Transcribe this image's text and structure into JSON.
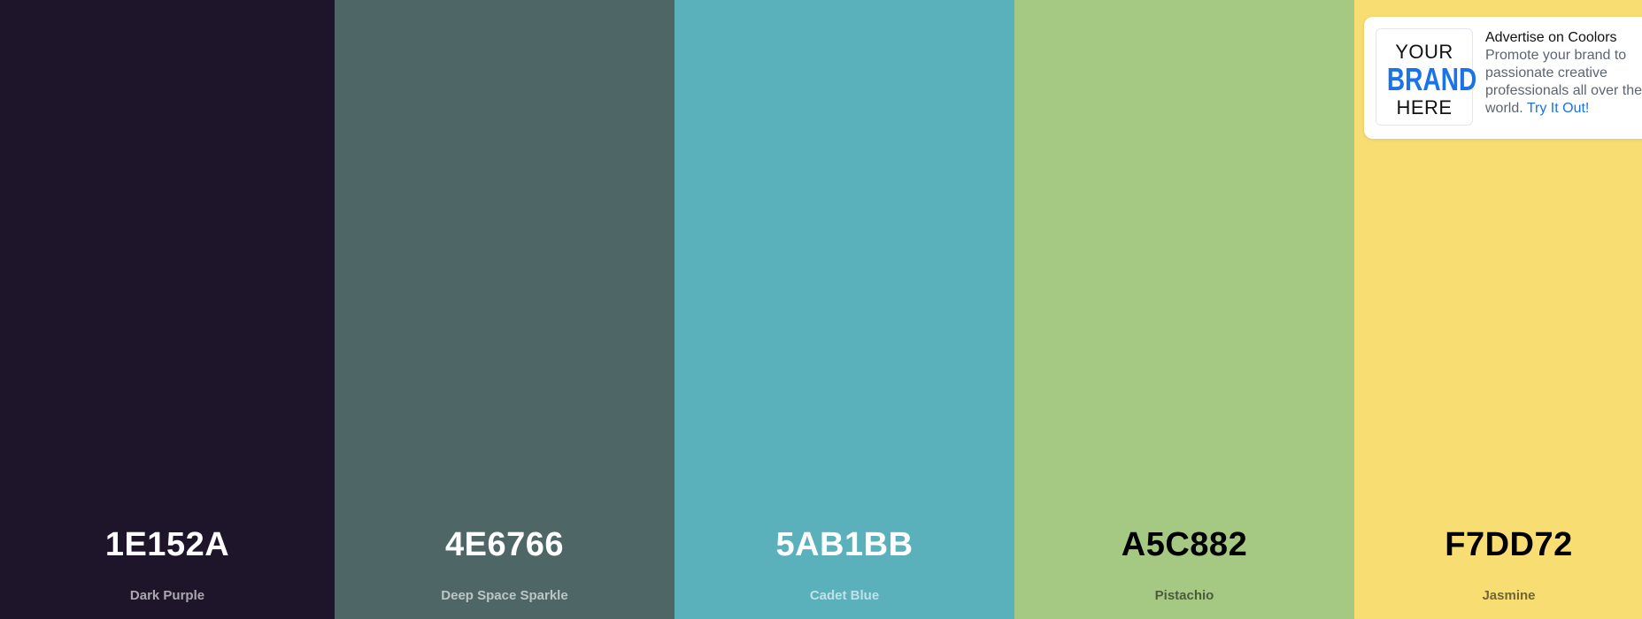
{
  "palette": {
    "colors": [
      {
        "hex": "1E152A",
        "name": "Dark Purple",
        "color": "#1E152A"
      },
      {
        "hex": "4E6766",
        "name": "Deep Space Sparkle",
        "color": "#4E6766"
      },
      {
        "hex": "5AB1BB",
        "name": "Cadet Blue",
        "color": "#5AB1BB"
      },
      {
        "hex": "A5C882",
        "name": "Pistachio",
        "color": "#A5C882"
      },
      {
        "hex": "F7DD72",
        "name": "Jasmine",
        "color": "#F7DD72"
      }
    ]
  },
  "ad": {
    "logo_line1": "YOUR",
    "logo_line2": "BRAND",
    "logo_line3": "HERE",
    "title": "Advertise on Coolors",
    "body": "Promote your brand to passionate creative professionals all over the world.",
    "link_label": "Try It Out!",
    "link_color": "#1A73E8"
  }
}
